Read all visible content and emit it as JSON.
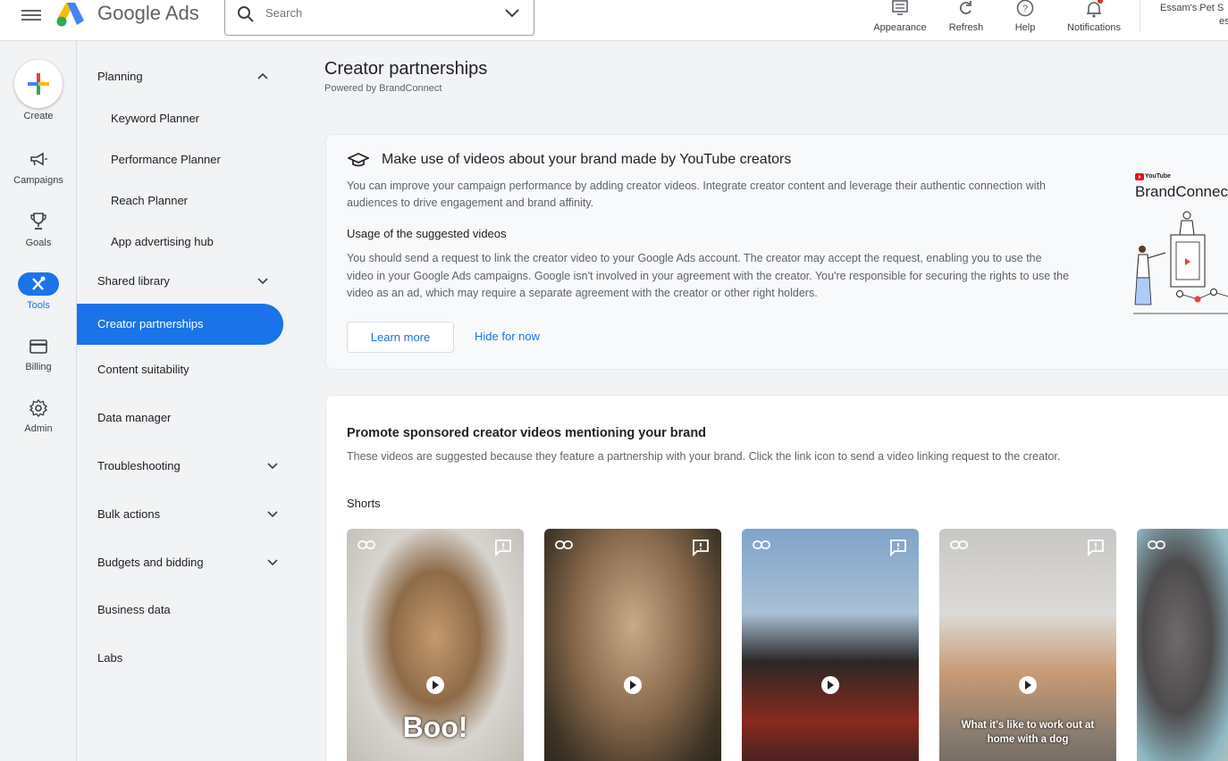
{
  "app": {
    "brand_google": "Google",
    "brand_ads": "Ads"
  },
  "search": {
    "placeholder": "Search"
  },
  "toolbar": {
    "appearance": "Appearance",
    "refresh": "Refresh",
    "help": "Help",
    "notifications": "Notifications"
  },
  "account": {
    "line1": "Essam's Pet S",
    "line2": "es"
  },
  "rail": {
    "create": "Create",
    "campaigns": "Campaigns",
    "goals": "Goals",
    "tools": "Tools",
    "billing": "Billing",
    "admin": "Admin"
  },
  "nav": {
    "planning": "Planning",
    "keyword_planner": "Keyword Planner",
    "performance_planner": "Performance Planner",
    "reach_planner": "Reach Planner",
    "app_advertising_hub": "App advertising hub",
    "shared_library": "Shared library",
    "creator_partnerships": "Creator partnerships",
    "content_suitability": "Content suitability",
    "data_manager": "Data manager",
    "troubleshooting": "Troubleshooting",
    "bulk_actions": "Bulk actions",
    "budgets_and_bidding": "Budgets and bidding",
    "business_data": "Business data",
    "labs": "Labs"
  },
  "page": {
    "title": "Creator partnerships",
    "powered_by": "Powered by BrandConnect"
  },
  "info_card": {
    "heading": "Make use of videos about your brand made by YouTube creators",
    "body": "You can improve your campaign performance by adding creator videos. Integrate creator content and leverage their authentic connection with audiences to drive engagement and brand affinity.",
    "usage_heading": "Usage of the suggested videos",
    "usage_body": "You should send a request to link the creator video to your Google Ads account. The creator may accept the request, enabling you to use the video in your Google Ads campaigns. Google isn't involved in your agreement with the creator. You're responsible for securing the rights to use the video as an ad, which may require a separate agreement with the creator or other right holders.",
    "learn_more": "Learn more",
    "hide_for_now": "Hide for now",
    "illus_youtube": "YouTube",
    "illus_brandconnect": "BrandConnect"
  },
  "promote_card": {
    "heading": "Promote sponsored creator videos mentioning your brand",
    "body": "These videos are suggested because they feature a partnership with your brand. Click the link icon to send a video linking request to the creator.",
    "shorts_label": "Shorts",
    "videos": [
      {
        "overlay": "Boo!"
      },
      {
        "overlay": ""
      },
      {
        "overlay": ""
      },
      {
        "overlay": "What it's like to work out at home with a dog"
      },
      {
        "overlay": ""
      }
    ]
  },
  "colors": {
    "accent": "#1a73e8",
    "text": "#202124",
    "muted": "#5f6368"
  }
}
